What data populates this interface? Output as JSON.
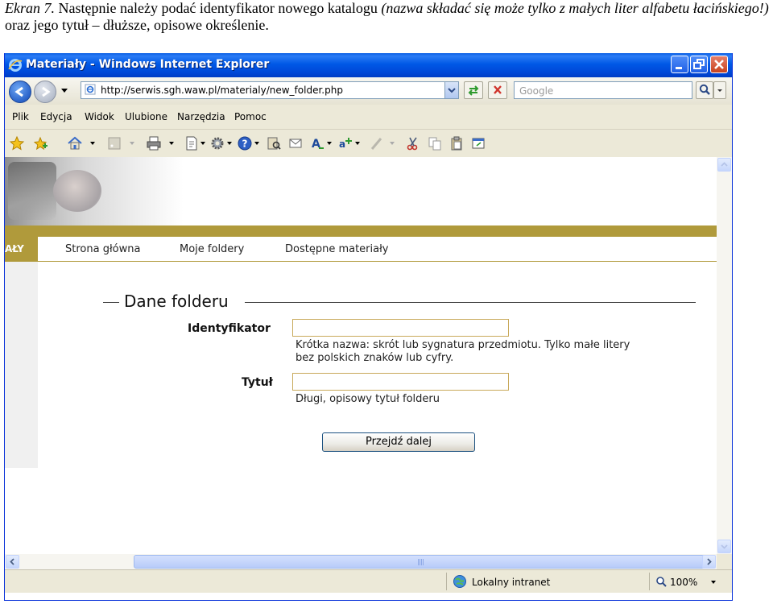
{
  "caption": {
    "lead": "Ekran 7.",
    "text1": " Następnie należy podać identyfikator nowego katalogu ",
    "italic": "(nazwa składać się może tylko z małych liter alfabetu łacińskiego!)",
    "text2": " oraz jego tytuł – dłuższe, opisowe określenie."
  },
  "window": {
    "title": "Materiały - Windows Internet Explorer",
    "address": "http://serwis.sgh.waw.pl/materialy/new_folder.php",
    "search_placeholder": "Google",
    "menu": [
      "Plik",
      "Edycja",
      "Widok",
      "Ulubione",
      "Narzędzia",
      "Pomoc"
    ]
  },
  "site": {
    "section_label": "AŁY",
    "nav": [
      "Strona główna",
      "Moje foldery",
      "Dostępne materiały"
    ],
    "accent": "#b09a3b"
  },
  "form": {
    "legend": "Dane folderu",
    "identifier_label": "Identyfikator",
    "identifier_value": "",
    "identifier_hint_1": "Krótka nazwa: skrót lub sygnatura przedmiotu. Tylko małe litery",
    "identifier_hint_2": "bez polskich znaków lub cyfry.",
    "title_label": "Tytuł",
    "title_value": "",
    "title_hint": "Długi, opisowy tytuł folderu",
    "submit_label": "Przejdź dalej"
  },
  "statusbar": {
    "zone": "Lokalny intranet",
    "zoom": "100%"
  }
}
